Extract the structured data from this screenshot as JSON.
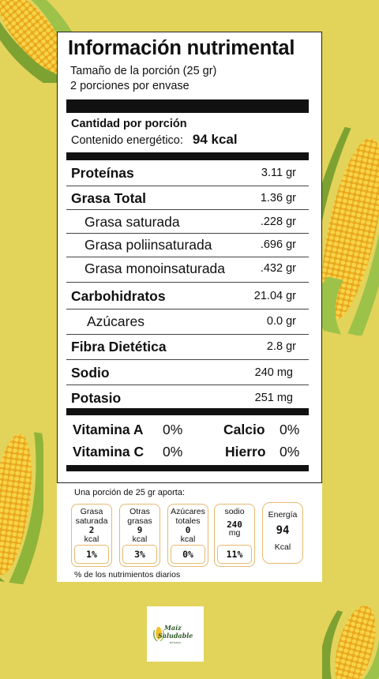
{
  "label": {
    "title": "Información nutrimental",
    "serving_size": "Tamaño de la porción (25 gr)",
    "servings_per_container": "2 porciones por envase",
    "amount_per_serving": "Cantidad por porción",
    "energy_label": "Contenido energético:",
    "energy_value": "94 kcal",
    "nutrients": [
      {
        "name": "Proteínas",
        "value": "3.11 gr"
      },
      {
        "name": "Grasa Total",
        "value": "1.36 gr"
      },
      {
        "name": "Grasa saturada",
        "value": ".228 gr"
      },
      {
        "name": "Grasa poliinsaturada",
        "value": ".696 gr"
      },
      {
        "name": "Grasa monoinsaturada",
        "value": ".432 gr"
      },
      {
        "name": "Carbohidratos",
        "value": "21.04 gr"
      },
      {
        "name": "Azúcares",
        "value": "0.0 gr"
      },
      {
        "name": "Fibra Dietética",
        "value": "2.8 gr"
      },
      {
        "name": "Sodio",
        "value": "240 mg"
      },
      {
        "name": "Potasio",
        "value": "251 mg"
      }
    ],
    "vitamins": [
      {
        "name": "Vitamina A",
        "value": "0%"
      },
      {
        "name": "Calcio",
        "value": "0%"
      },
      {
        "name": "Vitamina C",
        "value": "0%"
      },
      {
        "name": "Hierro",
        "value": "0%"
      }
    ]
  },
  "gda": {
    "title": "Una porción de 25 gr aporta:",
    "items": [
      {
        "line1": "Grasa",
        "line2": "saturada",
        "amount": "2",
        "unit": "kcal",
        "percent": "1%"
      },
      {
        "line1": "Otras",
        "line2": "grasas",
        "amount": "9",
        "unit": "kcal",
        "percent": "3%"
      },
      {
        "line1": "Azúcares",
        "line2": "totales",
        "amount": "0",
        "unit": "kcal",
        "percent": "0%"
      },
      {
        "line1": "sodio",
        "line2": "",
        "amount": "240",
        "unit": "mg",
        "percent": "11%"
      }
    ],
    "energy": {
      "label": "Energía",
      "amount": "94",
      "unit": "Kcal"
    },
    "note": "% de los nutrimientos diarios"
  },
  "logo": {
    "line1": "Maíz",
    "line2": "Saludable",
    "line3": "BOTANAS"
  },
  "colors": {
    "background": "#e2d35b",
    "corn": "#f2c12e",
    "husk": "#8fb43a",
    "gda_border": "#e8b870"
  }
}
